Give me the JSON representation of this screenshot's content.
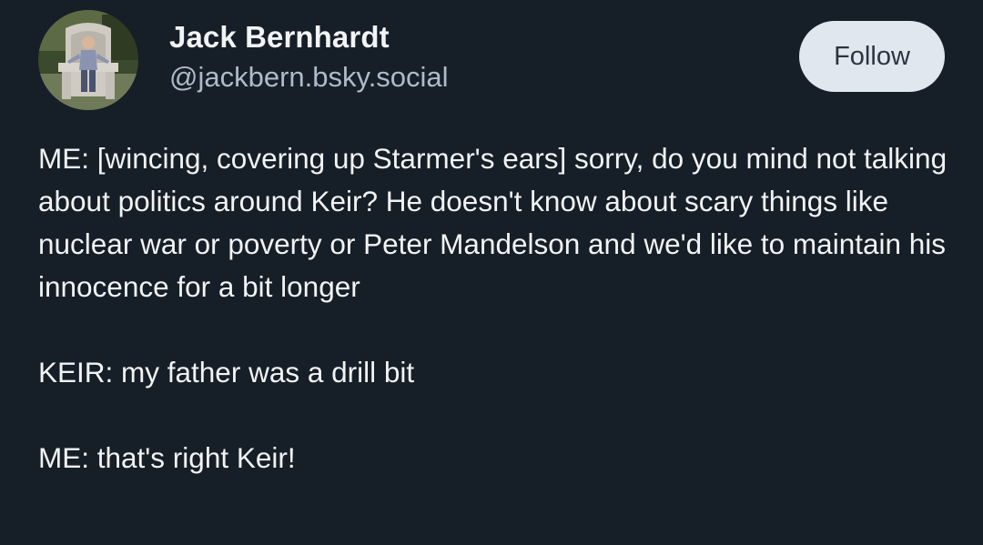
{
  "author": {
    "name": "Jack Bernhardt",
    "handle": "@jackbern.bsky.social"
  },
  "actions": {
    "follow_label": "Follow"
  },
  "post": {
    "paragraphs": [
      "ME: [wincing, covering up Starmer's ears] sorry, do you mind not talking about politics around Keir? He doesn't know about scary things like nuclear war or poverty or Peter Mandelson and we'd like to maintain his innocence for a bit longer",
      "KEIR: my father was a drill bit",
      "ME: that's right Keir!"
    ]
  },
  "colors": {
    "background": "#161e27",
    "text": "#f1f3f5",
    "handle": "#aebbc9",
    "follow_button_bg": "#e1e7ee",
    "follow_button_text": "#2a3541"
  }
}
